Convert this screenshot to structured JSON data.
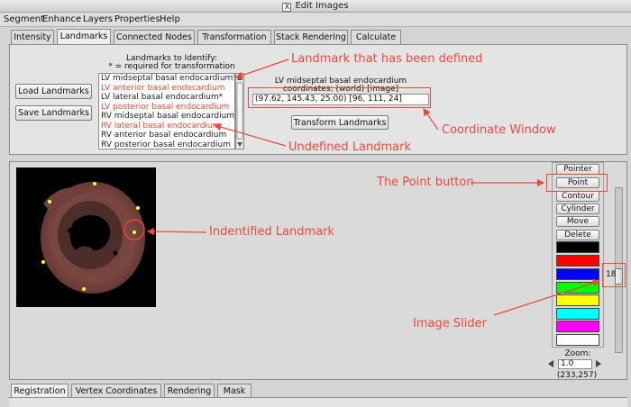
{
  "window": {
    "title": "Edit Images"
  },
  "menu": [
    "Segment",
    "Enhance",
    "Layers",
    "Properties",
    "Help"
  ],
  "tabs": [
    "Intensity",
    "Landmarks",
    "Connected Nodes",
    "Transformation",
    "Stack Rendering",
    "Calculate"
  ],
  "active_tab": "Landmarks",
  "landmarks": {
    "header_line1": "Landmarks to Identify:",
    "header_line2": "* = required for transformation",
    "load_button": "Load Landmarks",
    "save_button": "Save Landmarks",
    "items": [
      {
        "label": "LV midseptal basal endocardium*",
        "defined": false
      },
      {
        "label": "LV anterior basal endocardium",
        "defined": true
      },
      {
        "label": "LV lateral basal endocardium*",
        "defined": false
      },
      {
        "label": "LV posterior basal endocardium",
        "defined": true
      },
      {
        "label": "RV midseptal basal endocardium*",
        "defined": false
      },
      {
        "label": "RV lateral basal endocardium",
        "defined": true
      },
      {
        "label": "RV anterior basal endocardium",
        "defined": false
      },
      {
        "label": "RV posterior basal endocardium",
        "defined": false
      }
    ],
    "coord_title": "LV midseptal basal endocardium",
    "coord_subtitle": "coordinates: (world) [image]",
    "coord_value": "(97.62, 145.43, 25.00) [96, 111, 24]",
    "transform_button": "Transform Landmarks"
  },
  "tools": {
    "buttons": [
      "Pointer",
      "Point",
      "Contour",
      "Cylinder",
      "Move",
      "Delete"
    ],
    "swatches": [
      "#000000",
      "#ff0000",
      "#0000ff",
      "#00ff00",
      "#ffff00",
      "#00ffff",
      "#ff00ff",
      "#ffffff"
    ],
    "zoom_label": "Zoom:",
    "zoom_value": "1.0",
    "cursor_coords": "(233,257)"
  },
  "slider": {
    "value_label": "18"
  },
  "bottom_tabs": [
    "Registration",
    "Vertex Coordinates",
    "Rendering",
    "Mask"
  ],
  "annotations": {
    "defined_landmark": "Landmark that has been defined",
    "coordinate_window": "Coordinate Window",
    "undefined_landmark": "Undefined Landmark",
    "point_button": "The Point button",
    "identified_landmark": "Indentified Landmark",
    "image_slider": "Image Slider"
  },
  "colors": {
    "annotation": "#e84a3a",
    "defined_landmark": "#e84a3a",
    "landmark_dot": "#ffff33"
  }
}
